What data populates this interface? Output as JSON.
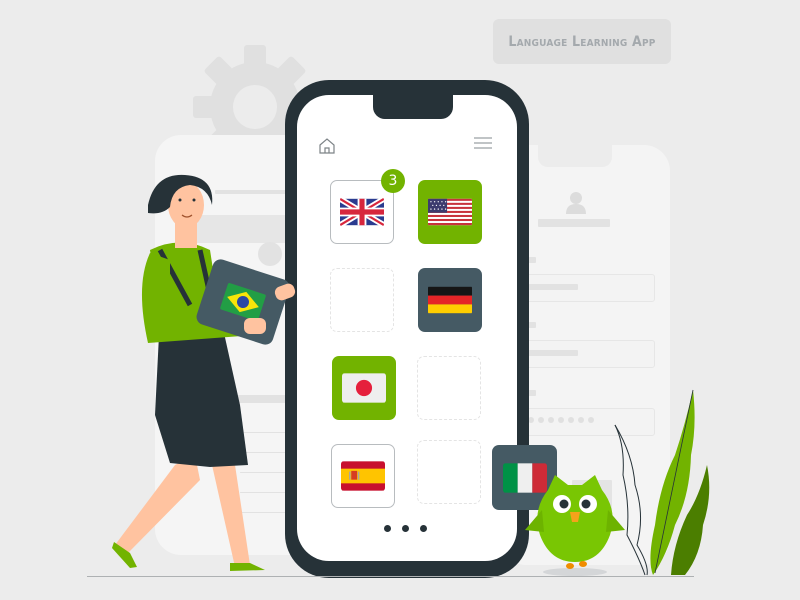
{
  "header": {
    "title": "Language Learning App"
  },
  "phone": {
    "nav": {
      "home_icon": "home-icon",
      "menu_icon": "hamburger-menu-icon"
    },
    "tiles": [
      {
        "language": "English (UK)",
        "flag": "uk-flag",
        "style": "white",
        "badge": "3"
      },
      {
        "language": "English (US)",
        "flag": "us-flag",
        "style": "green"
      },
      {
        "language": "",
        "flag": "",
        "style": "empty"
      },
      {
        "language": "German",
        "flag": "germany-flag",
        "style": "slate"
      },
      {
        "language": "Japanese",
        "flag": "japan-flag",
        "style": "green"
      },
      {
        "language": "",
        "flag": "",
        "style": "empty"
      },
      {
        "language": "Spanish",
        "flag": "spain-flag",
        "style": "white"
      },
      {
        "language": "",
        "flag": "",
        "style": "empty"
      }
    ],
    "pagination_dots": 3
  },
  "floating_cards": [
    {
      "language": "Italian",
      "flag": "italy-flag"
    },
    {
      "language": "Portuguese (Brazil)",
      "flag": "brazil-flag"
    }
  ],
  "colors": {
    "accent_green": "#72b300",
    "phone_frame": "#263238",
    "slate_tile": "#455a64",
    "title_text": "#a4a9ad",
    "background": "#ececec"
  }
}
